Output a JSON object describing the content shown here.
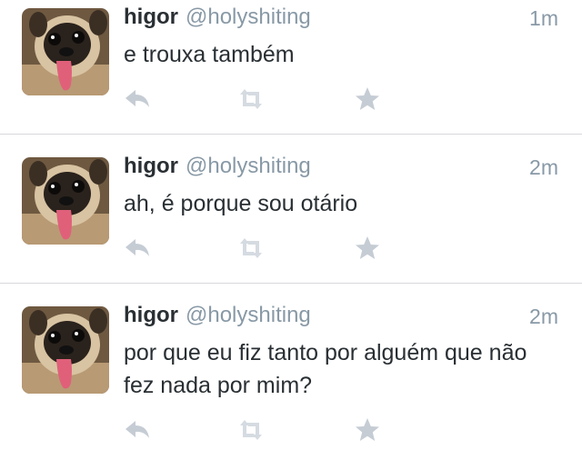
{
  "tweets": [
    {
      "name": "higor",
      "handle": "@holyshiting",
      "time": "1m",
      "text": "e trouxa também"
    },
    {
      "name": "higor",
      "handle": "@holyshiting",
      "time": "2m",
      "text": "ah, é porque sou otário"
    },
    {
      "name": "higor",
      "handle": "@holyshiting",
      "time": "2m",
      "text": "por que eu fiz tanto por alguém que não fez nada por mim?"
    }
  ],
  "icons": {
    "reply": "reply-icon",
    "retweet": "retweet-icon",
    "favorite": "star-icon",
    "avatar": "pug-avatar"
  },
  "colors": {
    "name": "#292f33",
    "secondary": "#8899a6",
    "icon": "#c5ccd4",
    "divider": "#d8d8dc",
    "background": "#ffffff"
  }
}
